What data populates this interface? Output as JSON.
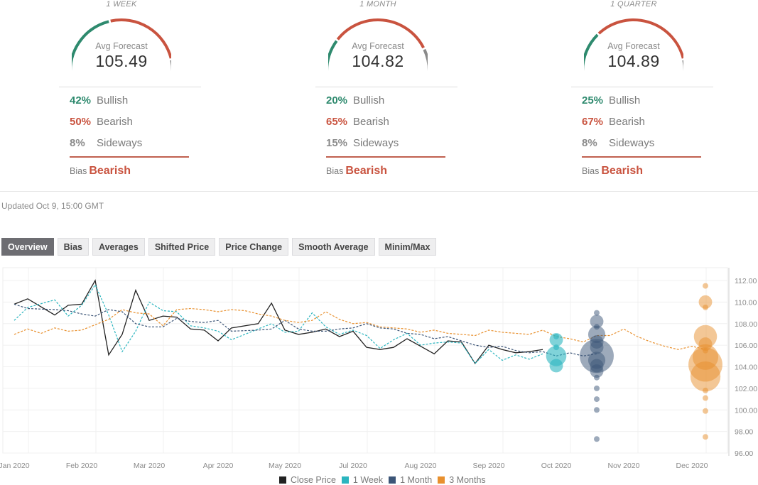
{
  "forecasts": [
    {
      "period": "1 WEEK",
      "avg_label": "Avg Forecast",
      "avg_value": "105.49",
      "bullish_pct": "42%",
      "bullish_label": "Bullish",
      "bullish_share": 0.42,
      "bearish_pct": "50%",
      "bearish_label": "Bearish",
      "bearish_share": 0.5,
      "sideways_pct": "8%",
      "sideways_label": "Sideways",
      "sideways_share": 0.08,
      "bias_label": "Bias",
      "bias_value": "Bearish"
    },
    {
      "period": "1 MONTH",
      "avg_label": "Avg Forecast",
      "avg_value": "104.82",
      "bullish_pct": "20%",
      "bullish_label": "Bullish",
      "bullish_share": 0.2,
      "bearish_pct": "65%",
      "bearish_label": "Bearish",
      "bearish_share": 0.65,
      "sideways_pct": "15%",
      "sideways_label": "Sideways",
      "sideways_share": 0.15,
      "bias_label": "Bias",
      "bias_value": "Bearish"
    },
    {
      "period": "1 QUARTER",
      "avg_label": "Avg Forecast",
      "avg_value": "104.89",
      "bullish_pct": "25%",
      "bullish_label": "Bullish",
      "bullish_share": 0.25,
      "bearish_pct": "67%",
      "bearish_label": "Bearish",
      "bearish_share": 0.67,
      "sideways_pct": "8%",
      "sideways_label": "Sideways",
      "sideways_share": 0.08,
      "bias_label": "Bias",
      "bias_value": "Bearish"
    }
  ],
  "colors": {
    "bullish": "#2e8a6e",
    "bearish": "#c9533f",
    "sideways": "#8a8a8a",
    "close_price": "#222222",
    "week": "#2bb5bf",
    "month": "#3c5577",
    "quarter": "#e8902e"
  },
  "updated": "Updated Oct 9, 15:00 GMT",
  "tabs": [
    "Overview",
    "Bias",
    "Averages",
    "Shifted Price",
    "Price Change",
    "Smooth Average",
    "Minim/Max"
  ],
  "active_tab": "Overview",
  "chart_data": {
    "type": "line",
    "title": "",
    "xlabel": "",
    "ylabel": "",
    "ylim": [
      96,
      112
    ],
    "y_ticks": [
      "112.00",
      "110.00",
      "108.00",
      "106.00",
      "104.00",
      "102.00",
      "100.00",
      "98.00",
      "96.00"
    ],
    "x_tick_labels": [
      "Jan 2020",
      "Feb 2020",
      "Mar 2020",
      "Apr 2020",
      "May 2020",
      "Jul 2020",
      "Aug 2020",
      "Sep 2020",
      "Oct 2020",
      "Nov 2020",
      "Dec 2020"
    ],
    "x_range_months": [
      0,
      11.5
    ],
    "grid": true,
    "legend_position": "bottom",
    "series": [
      {
        "name": "Close Price",
        "style": "solid",
        "x": [
          0,
          0.2,
          0.6,
          0.8,
          1.0,
          1.2,
          1.4,
          1.6,
          1.8,
          2.0,
          2.2,
          2.4,
          2.6,
          2.8,
          3.0,
          3.2,
          3.6,
          3.8,
          4.0,
          4.2,
          4.4,
          4.6,
          4.8,
          5.0,
          5.2,
          5.4,
          5.6,
          5.8,
          6.0,
          6.2,
          6.4,
          6.6,
          6.8,
          7.0,
          7.2,
          7.4,
          7.6,
          7.8
        ],
        "values": [
          109.8,
          110.3,
          108.8,
          109.7,
          109.8,
          112.0,
          105.1,
          107.0,
          111.1,
          108.3,
          108.7,
          108.6,
          107.5,
          107.4,
          106.4,
          107.6,
          108.0,
          109.9,
          107.4,
          107.0,
          107.2,
          107.5,
          106.8,
          107.3,
          105.8,
          105.6,
          105.8,
          106.6,
          105.9,
          105.2,
          106.4,
          106.3,
          104.3,
          106.0,
          105.6,
          105.3,
          105.4,
          105.6
        ]
      },
      {
        "name": "1 Week",
        "style": "dashed",
        "x": [
          0,
          0.2,
          0.6,
          0.8,
          1.0,
          1.2,
          1.4,
          1.6,
          1.8,
          2.0,
          2.2,
          2.4,
          2.6,
          2.8,
          3.0,
          3.2,
          3.6,
          3.8,
          4.0,
          4.2,
          4.4,
          4.6,
          4.8,
          5.0,
          5.2,
          5.4,
          5.6,
          5.8,
          6.0,
          6.2,
          6.4,
          6.6,
          6.8,
          7.0,
          7.2,
          7.4,
          7.6,
          7.8
        ],
        "values": [
          108.3,
          109.5,
          110.2,
          108.7,
          109.7,
          111.6,
          108.8,
          105.4,
          107.3,
          110.0,
          109.2,
          109.1,
          107.8,
          107.6,
          107.3,
          106.5,
          107.5,
          108.0,
          107.2,
          107.3,
          109.0,
          107.7,
          107.0,
          107.4,
          106.9,
          105.7,
          106.5,
          107.1,
          106.0,
          106.2,
          106.3,
          106.2,
          104.3,
          105.6,
          104.6,
          105.1,
          104.7,
          105.2
        ]
      },
      {
        "name": "1 Month",
        "style": "dashed",
        "x": [
          0,
          0.2,
          0.6,
          0.8,
          1.0,
          1.2,
          1.4,
          1.6,
          1.8,
          2.0,
          2.2,
          2.4,
          2.6,
          2.8,
          3.0,
          3.2,
          3.6,
          3.8,
          4.0,
          4.2,
          4.4,
          4.6,
          4.8,
          5.0,
          5.2,
          5.4,
          5.6,
          5.8,
          6.0,
          6.2,
          6.4,
          6.6,
          6.8,
          7.0,
          7.2,
          7.4,
          7.6,
          7.8,
          8.0,
          8.2,
          8.4,
          8.6
        ],
        "values": [
          109.8,
          109.4,
          109.3,
          109.2,
          108.9,
          108.7,
          109.3,
          109.1,
          108.0,
          107.7,
          107.7,
          108.5,
          108.2,
          108.1,
          108.3,
          107.3,
          107.4,
          107.5,
          108.3,
          107.5,
          107.3,
          107.3,
          107.5,
          107.6,
          108.0,
          107.6,
          107.5,
          107.1,
          107.0,
          106.6,
          106.8,
          106.4,
          106.0,
          105.8,
          105.9,
          105.5,
          105.3,
          105.4,
          105.0,
          105.3,
          105.0,
          105.2
        ]
      },
      {
        "name": "3 Months",
        "style": "dashed",
        "x": [
          0,
          0.2,
          0.4,
          0.6,
          0.8,
          1.0,
          1.2,
          1.4,
          1.6,
          1.8,
          2.0,
          2.2,
          2.4,
          2.6,
          2.8,
          3.0,
          3.2,
          3.4,
          3.6,
          3.8,
          4.0,
          4.2,
          4.4,
          4.6,
          4.8,
          5.0,
          5.2,
          5.4,
          5.6,
          5.8,
          6.0,
          6.2,
          6.4,
          6.6,
          6.8,
          7.0,
          7.2,
          7.4,
          7.6,
          7.8,
          8.0,
          8.2,
          8.4,
          8.6,
          8.8,
          9.0,
          9.2,
          9.4,
          9.6,
          9.8,
          10.0,
          10.2
        ],
        "values": [
          107.0,
          107.5,
          107.1,
          107.6,
          107.3,
          107.4,
          107.9,
          108.4,
          109.3,
          109.0,
          108.9,
          107.8,
          109.3,
          109.4,
          109.3,
          109.1,
          109.3,
          109.2,
          108.9,
          108.7,
          108.3,
          108.1,
          108.3,
          109.1,
          108.4,
          108.0,
          108.1,
          107.7,
          107.6,
          107.5,
          107.2,
          107.4,
          107.1,
          107.0,
          106.9,
          107.4,
          107.2,
          107.1,
          107.0,
          107.4,
          106.8,
          106.6,
          106.3,
          106.9,
          106.9,
          107.5,
          106.8,
          106.3,
          105.9,
          105.6,
          105.9,
          105.6
        ]
      }
    ],
    "bubbles": [
      {
        "series": "1 Week",
        "x": 8.0,
        "points": [
          {
            "y": 106.8,
            "size": 1
          },
          {
            "y": 106.5,
            "size": 2
          },
          {
            "y": 105.8,
            "size": 1
          },
          {
            "y": 105.0,
            "size": 4
          },
          {
            "y": 104.1,
            "size": 2
          }
        ]
      },
      {
        "series": "1 Month",
        "x": 8.6,
        "points": [
          {
            "y": 109.0,
            "size": 1
          },
          {
            "y": 108.2,
            "size": 2
          },
          {
            "y": 107.7,
            "size": 1
          },
          {
            "y": 107.0,
            "size": 3
          },
          {
            "y": 106.3,
            "size": 2
          },
          {
            "y": 105.8,
            "size": 2
          },
          {
            "y": 105.0,
            "size": 10
          },
          {
            "y": 104.6,
            "size": 3
          },
          {
            "y": 104.1,
            "size": 2
          },
          {
            "y": 103.6,
            "size": 2
          },
          {
            "y": 103.0,
            "size": 1
          },
          {
            "y": 102.0,
            "size": 1
          },
          {
            "y": 101.0,
            "size": 1
          },
          {
            "y": 100.0,
            "size": 1
          },
          {
            "y": 97.3,
            "size": 1
          }
        ]
      },
      {
        "series": "3 Months",
        "x": 10.2,
        "points": [
          {
            "y": 111.5,
            "size": 1
          },
          {
            "y": 110.0,
            "size": 2
          },
          {
            "y": 109.5,
            "size": 1
          },
          {
            "y": 106.8,
            "size": 5
          },
          {
            "y": 106.1,
            "size": 2
          },
          {
            "y": 105.5,
            "size": 1
          },
          {
            "y": 104.9,
            "size": 6
          },
          {
            "y": 104.2,
            "size": 10
          },
          {
            "y": 103.1,
            "size": 8
          },
          {
            "y": 101.8,
            "size": 1
          },
          {
            "y": 101.1,
            "size": 1
          },
          {
            "y": 99.9,
            "size": 1
          },
          {
            "y": 97.5,
            "size": 1
          }
        ]
      }
    ]
  },
  "legend": [
    {
      "name": "Close Price",
      "color": "#222222"
    },
    {
      "name": "1 Week",
      "color": "#2bb5bf"
    },
    {
      "name": "1 Month",
      "color": "#3c5577"
    },
    {
      "name": "3 Months",
      "color": "#e8902e"
    }
  ]
}
